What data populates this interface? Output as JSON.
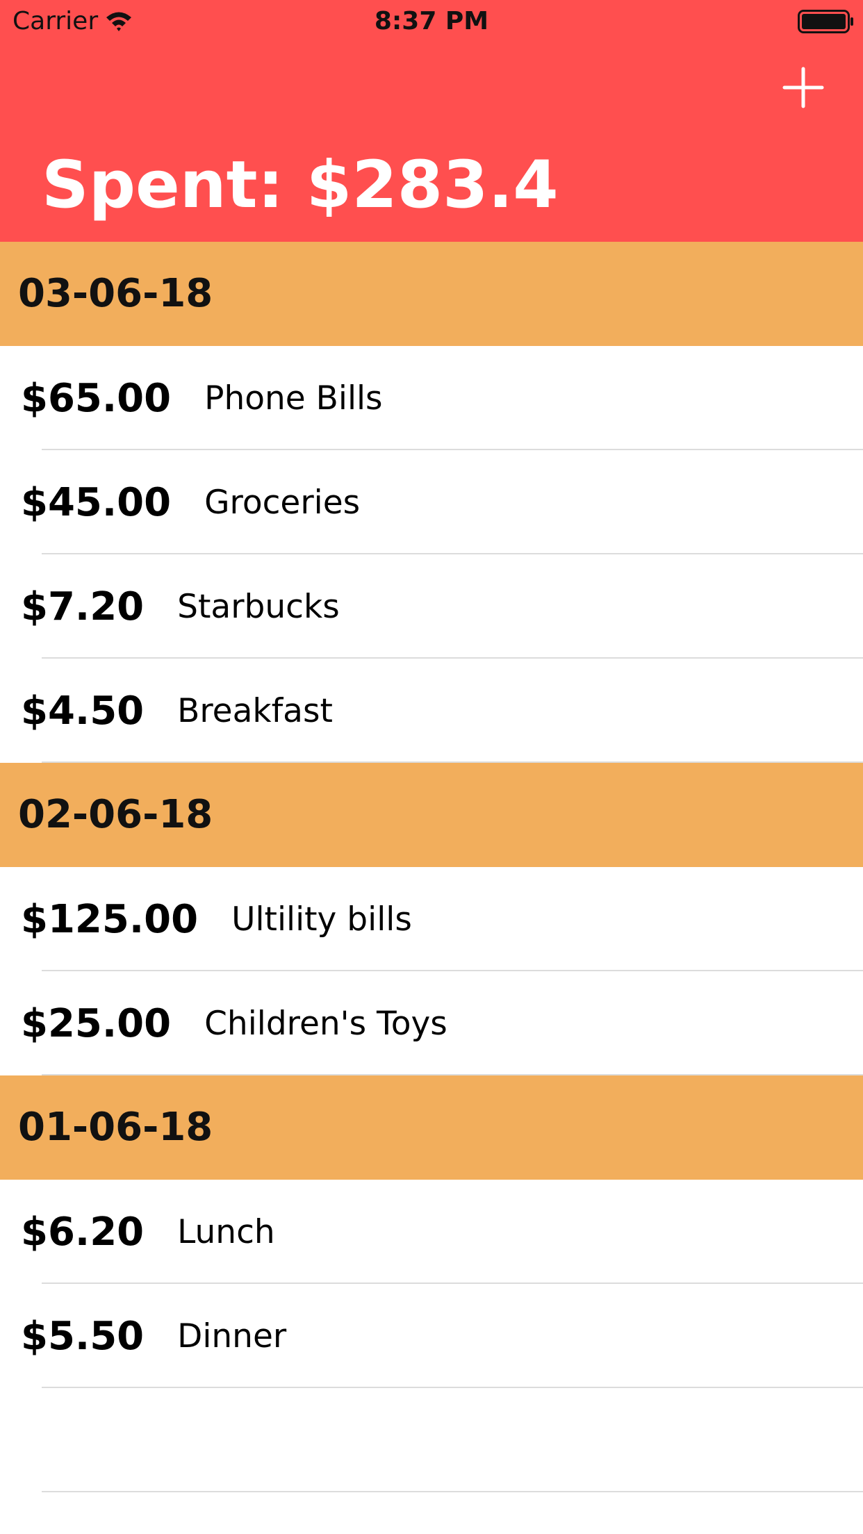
{
  "status_bar": {
    "carrier": "Carrier",
    "time": "8:37 PM",
    "wifi_icon": "wifi-icon",
    "battery_icon": "battery-icon"
  },
  "header": {
    "title": "Spent: $283.4",
    "add_icon": "plus-icon",
    "background_color": "#ff4f4f"
  },
  "sections": [
    {
      "date": "03-06-18",
      "items": [
        {
          "amount": "$65.00",
          "description": "Phone Bills"
        },
        {
          "amount": "$45.00",
          "description": "Groceries"
        },
        {
          "amount": "$7.20",
          "description": "Starbucks"
        },
        {
          "amount": "$4.50",
          "description": "Breakfast"
        }
      ]
    },
    {
      "date": "02-06-18",
      "items": [
        {
          "amount": "$125.00",
          "description": "Ultility bills"
        },
        {
          "amount": "$25.00",
          "description": "Children's Toys"
        }
      ]
    },
    {
      "date": "01-06-18",
      "items": [
        {
          "amount": "$6.20",
          "description": "Lunch"
        },
        {
          "amount": "$5.50",
          "description": "Dinner"
        }
      ]
    }
  ],
  "colors": {
    "header_background": "#ff4f4f",
    "section_background": "#f2ae5c",
    "row_background": "#ffffff",
    "separator": "#dcdcdc"
  }
}
